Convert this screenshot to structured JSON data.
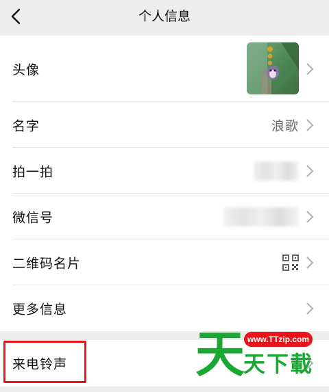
{
  "header": {
    "title": "个人信息"
  },
  "rows": [
    {
      "label": "头像"
    },
    {
      "label": "名字",
      "value": "浪歌"
    },
    {
      "label": "拍一拍"
    },
    {
      "label": "微信号"
    },
    {
      "label": "二维码名片"
    },
    {
      "label": "更多信息"
    }
  ],
  "ringtone": {
    "label": "来电铃声"
  },
  "watermark": {
    "url": "www.TTzip.com",
    "big": "天",
    "small": "天下載"
  },
  "colors": {
    "background": "#ededed",
    "highlight_box": "#e8141b",
    "watermark_green": "#1aa832"
  },
  "icons": {
    "back": "chevron-left-icon",
    "row_arrow": "chevron-right-icon",
    "qr": "qr-code-icon"
  }
}
